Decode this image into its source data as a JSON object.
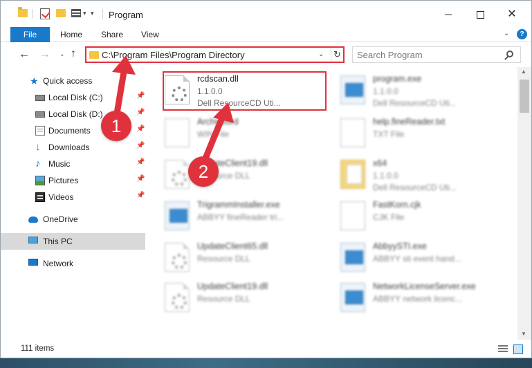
{
  "window": {
    "title": "Program"
  },
  "ribbon": {
    "file": "File",
    "home": "Home",
    "share": "Share",
    "view": "View",
    "help": "?"
  },
  "address": {
    "path": "C:\\Program Files\\Program Directory"
  },
  "search": {
    "placeholder": "Search Program"
  },
  "sidebar": {
    "items": [
      {
        "label": "Quick access",
        "icon": "star-icon",
        "pinned": false
      },
      {
        "label": "Local Disk (C:)",
        "icon": "drive-icon",
        "pinned": true
      },
      {
        "label": "Local Disk (D:)",
        "icon": "drive-icon",
        "pinned": true
      },
      {
        "label": "Documents",
        "icon": "documents-icon",
        "pinned": true
      },
      {
        "label": "Downloads",
        "icon": "download-icon",
        "pinned": true
      },
      {
        "label": "Music",
        "icon": "music-icon",
        "pinned": true
      },
      {
        "label": "Pictures",
        "icon": "pictures-icon",
        "pinned": true
      },
      {
        "label": "Videos",
        "icon": "videos-icon",
        "pinned": true
      },
      {
        "label": "OneDrive",
        "icon": "onedrive-icon",
        "pinned": false
      },
      {
        "label": "This PC",
        "icon": "computer-icon",
        "pinned": false,
        "selected": true
      },
      {
        "label": "Network",
        "icon": "network-icon",
        "pinned": false
      }
    ]
  },
  "files": [
    {
      "name": "rcdscan.dll",
      "line1": "1.1.0.0",
      "line2": "Dell ResourceCD Uti...",
      "icon": "dll-file-icon",
      "blurred": false
    },
    {
      "name": "program.exe",
      "line1": "1.1.0.0",
      "line2": "Dell ResourceCD Uti...",
      "icon": "exe-file-icon",
      "blurred": true
    },
    {
      "name": "Archiveord",
      "line1": "WIN File",
      "line2": "",
      "icon": "text-file-icon",
      "blurred": true
    },
    {
      "name": "help.fineReader.txt",
      "line1": "TXT File",
      "line2": "",
      "icon": "text-file-icon",
      "blurred": true
    },
    {
      "name": "UpdateClient19.dll",
      "line1": "Resource DLL",
      "line2": "",
      "icon": "dll-file-icon",
      "blurred": true
    },
    {
      "name": "x64",
      "line1": "1.1.0.0",
      "line2": "Dell ResourceCD Uti...",
      "icon": "folder-file-icon",
      "blurred": true
    },
    {
      "name": "TrigrammInstaller.exe",
      "line1": "ABBYY fineReader tri...",
      "line2": "",
      "icon": "exe-file-icon",
      "blurred": true
    },
    {
      "name": "FastKorn.cjk",
      "line1": "CJK File",
      "line2": "",
      "icon": "text-file-icon",
      "blurred": true
    },
    {
      "name": "UpdateClient65.dll",
      "line1": "Resource DLL",
      "line2": "",
      "icon": "dll-file-icon",
      "blurred": true
    },
    {
      "name": "AbbyySTI.exe",
      "line1": "ABBYY sti event hand...",
      "line2": "",
      "icon": "exe-file-icon",
      "blurred": true
    },
    {
      "name": "UpdateClient19.dll",
      "line1": "Resource DLL",
      "line2": "",
      "icon": "dll-file-icon",
      "blurred": true
    },
    {
      "name": "NetworkLicenseServer.exe",
      "line1": "ABBYY network licenc...",
      "line2": "",
      "icon": "exe-file-icon",
      "blurred": true
    }
  ],
  "status": {
    "count": "111 items"
  },
  "callouts": {
    "one": "1",
    "two": "2"
  },
  "colors": {
    "accent": "#1979ca",
    "highlight": "#e0323d"
  }
}
